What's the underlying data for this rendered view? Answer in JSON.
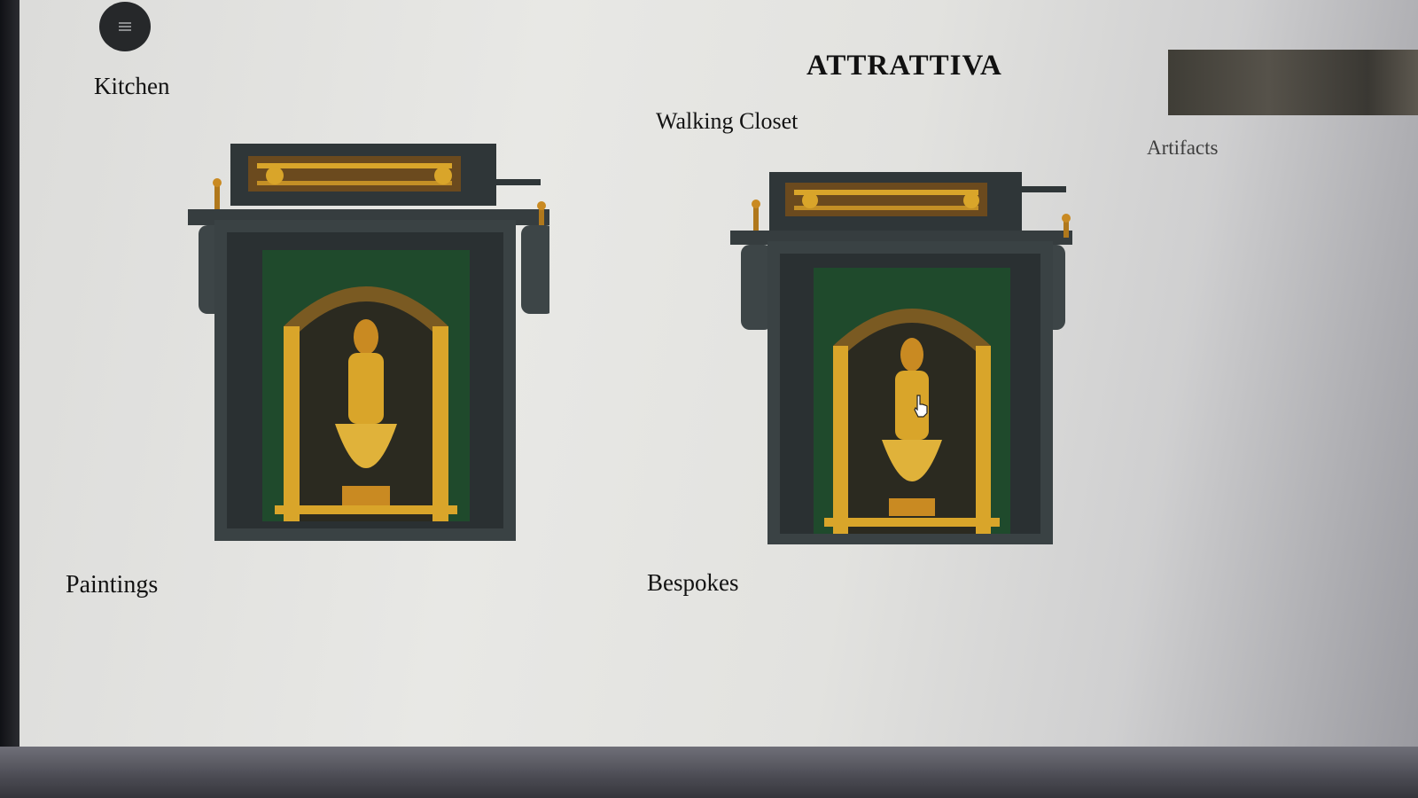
{
  "brand": {
    "name": "ATTRATTIVA"
  },
  "nav": {
    "menu_icon": "hamburger-icon",
    "items": [
      {
        "label": "Kitchen"
      },
      {
        "label": "Walking Closet"
      },
      {
        "label": "Artifacts"
      },
      {
        "label": "Paintings"
      },
      {
        "label": "Bespokes"
      }
    ]
  },
  "gallery": {
    "items": [
      {
        "image": "framed-deity-artwork"
      },
      {
        "image": "framed-deity-artwork"
      }
    ]
  },
  "colors": {
    "frame": "#3a4244",
    "gold": "#d9a52a",
    "inner_green": "#1f4a2c",
    "menu_button": "#26282a"
  }
}
